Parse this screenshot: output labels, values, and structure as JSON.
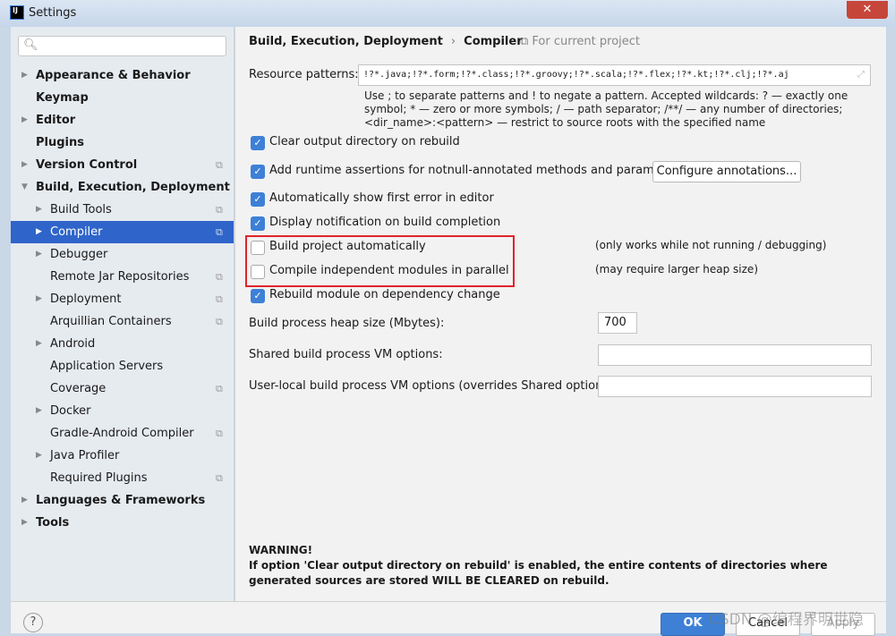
{
  "window": {
    "title": "Settings",
    "logo": "IJ",
    "close": "✕"
  },
  "search": {
    "icon": "🔍︎",
    "placeholder": ""
  },
  "sidebar": {
    "items": [
      {
        "label": "Appearance & Behavior",
        "bold": true,
        "arrow": "▶",
        "level": 0
      },
      {
        "label": "Keymap",
        "bold": true,
        "level": 0
      },
      {
        "label": "Editor",
        "bold": true,
        "arrow": "▶",
        "level": 0
      },
      {
        "label": "Plugins",
        "bold": true,
        "level": 0
      },
      {
        "label": "Version Control",
        "bold": true,
        "arrow": "▶",
        "level": 0,
        "copy": true
      },
      {
        "label": "Build, Execution, Deployment",
        "bold": true,
        "arrow": "▼",
        "level": 0
      },
      {
        "label": "Build Tools",
        "arrow": "▶",
        "level": 1,
        "copy": true
      },
      {
        "label": "Compiler",
        "arrow": "▶",
        "level": 1,
        "copy": true,
        "selected": true
      },
      {
        "label": "Debugger",
        "arrow": "▶",
        "level": 1
      },
      {
        "label": "Remote Jar Repositories",
        "level": 1,
        "copy": true
      },
      {
        "label": "Deployment",
        "arrow": "▶",
        "level": 1,
        "copy": true
      },
      {
        "label": "Arquillian Containers",
        "level": 1,
        "copy": true
      },
      {
        "label": "Android",
        "arrow": "▶",
        "level": 1
      },
      {
        "label": "Application Servers",
        "level": 1
      },
      {
        "label": "Coverage",
        "level": 1,
        "copy": true
      },
      {
        "label": "Docker",
        "arrow": "▶",
        "level": 1
      },
      {
        "label": "Gradle-Android Compiler",
        "level": 1,
        "copy": true
      },
      {
        "label": "Java Profiler",
        "arrow": "▶",
        "level": 1
      },
      {
        "label": "Required Plugins",
        "level": 1,
        "copy": true
      },
      {
        "label": "Languages & Frameworks",
        "bold": true,
        "arrow": "▶",
        "level": 0
      },
      {
        "label": "Tools",
        "bold": true,
        "arrow": "▶",
        "level": 0
      }
    ]
  },
  "main": {
    "breadcrumb": {
      "parent": "Build, Execution, Deployment",
      "sep": "›",
      "current": "Compiler"
    },
    "for_project": "⧉ For current project",
    "resource_label": "Resource patterns:",
    "resource_value": "!?*.java;!?*.form;!?*.class;!?*.groovy;!?*.scala;!?*.flex;!?*.kt;!?*.clj;!?*.aj",
    "hint": "Use ; to separate patterns and ! to negate a pattern. Accepted wildcards: ? — exactly one symbol; * — zero or more symbols; / — path separator; /**/ — any number of directories; <dir_name>:<pattern> — restrict to source roots with the specified name",
    "options": [
      {
        "label": "Clear output directory on rebuild",
        "checked": true
      },
      {
        "label": "Add runtime assertions for notnull-annotated methods and parameters",
        "checked": true
      },
      {
        "label": "Automatically show first error in editor",
        "checked": true
      },
      {
        "label": "Display notification on build completion",
        "checked": true
      },
      {
        "label": "Build project automatically",
        "checked": false,
        "note": "(only works while not running / debugging)"
      },
      {
        "label": "Compile independent modules in parallel",
        "checked": false,
        "note": "(may require larger heap size)"
      },
      {
        "label": "Rebuild module on dependency change",
        "checked": true
      }
    ],
    "configure_annotations": "Configure annotations...",
    "heap_label": "Build process heap size (Mbytes):",
    "heap_value": "700",
    "shared_label": "Shared build process VM options:",
    "shared_value": "",
    "user_label": "User-local build process VM options (overrides Shared options):",
    "user_value": "",
    "warning_title": "WARNING!",
    "warning_text": "If option 'Clear output directory on rebuild' is enabled, the entire contents of directories where generated sources are stored WILL BE CLEARED on rebuild."
  },
  "footer": {
    "help": "?",
    "ok": "OK",
    "cancel": "Cancel",
    "apply": "Apply",
    "watermark": "CSDN @编程界明世隐"
  },
  "colors": {
    "selection": "#2f65ca",
    "ok": "#3d80d6",
    "highlight": "#e0242b"
  }
}
